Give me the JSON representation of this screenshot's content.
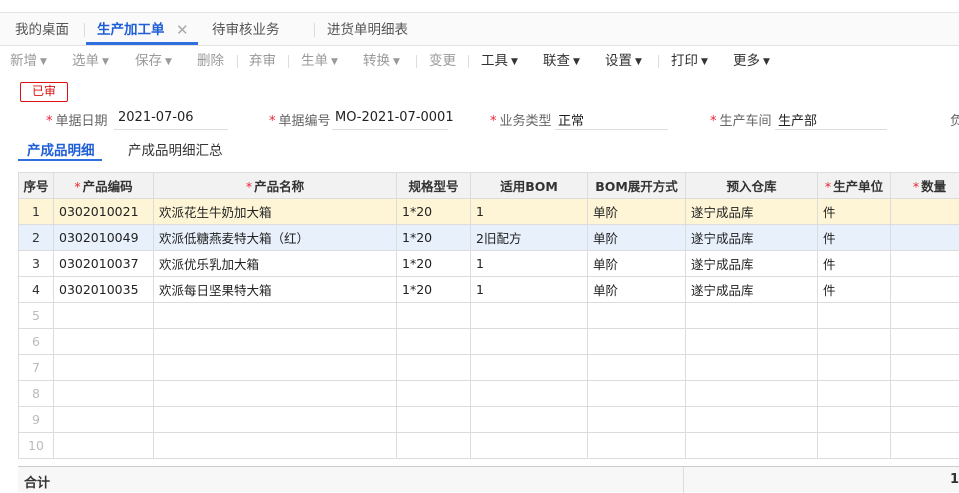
{
  "tabs": [
    {
      "label": "我的桌面"
    },
    {
      "label": "生产加工单"
    },
    {
      "label": "待审核业务"
    },
    {
      "label": "进货单明细表"
    }
  ],
  "toolbar": {
    "add": "新增",
    "select": "选单",
    "save": "保存",
    "delete": "删除",
    "abandon": "弃审",
    "generate": "生单",
    "convert": "转换",
    "change": "变更",
    "tools": "工具",
    "linked_query": "联查",
    "settings": "设置",
    "print": "打印",
    "more": "更多"
  },
  "status_badge": "已审",
  "header": {
    "doc_date_label": "单据日期",
    "doc_date_value": "2021-07-06",
    "doc_no_label": "单据编号",
    "doc_no_value": "MO-2021-07-0001",
    "biz_type_label": "业务类型",
    "biz_type_value": "正常",
    "workshop_label": "生产车间",
    "workshop_value": "生产部",
    "cut_off_label": "负"
  },
  "subtabs": [
    {
      "label": "产成品明细"
    },
    {
      "label": "产成品明细汇总"
    }
  ],
  "table": {
    "columns": [
      "序号",
      "产品编码",
      "产品名称",
      "规格型号",
      "适用BOM",
      "BOM展开方式",
      "预入仓库",
      "生产单位",
      "数量"
    ],
    "rows": [
      {
        "idx": "1",
        "code": "0302010021",
        "name": "欢派花生牛奶加大箱",
        "spec": "1*20",
        "bom": "1",
        "expand": "单阶",
        "warehouse": "遂宁成品库",
        "unit": "件"
      },
      {
        "idx": "2",
        "code": "0302010049",
        "name": "欢派低糖燕麦特大箱（红）",
        "spec": "1*20",
        "bom": "2旧配方",
        "expand": "单阶",
        "warehouse": "遂宁成品库",
        "unit": "件"
      },
      {
        "idx": "3",
        "code": "0302010037",
        "name": "欢派优乐乳加大箱",
        "spec": "1*20",
        "bom": "1",
        "expand": "单阶",
        "warehouse": "遂宁成品库",
        "unit": "件"
      },
      {
        "idx": "4",
        "code": "0302010035",
        "name": "欢派每日坚果特大箱",
        "spec": "1*20",
        "bom": "1",
        "expand": "单阶",
        "warehouse": "遂宁成品库",
        "unit": "件"
      }
    ],
    "empty_rows": [
      "5",
      "6",
      "7",
      "8",
      "9",
      "10"
    ]
  },
  "total": {
    "label": "合计",
    "value": "1"
  }
}
